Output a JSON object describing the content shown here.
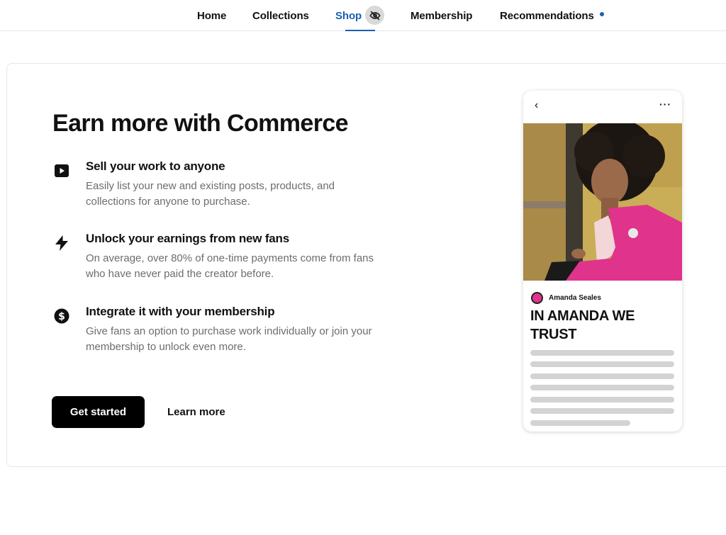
{
  "nav": {
    "items": [
      {
        "label": "Home"
      },
      {
        "label": "Collections"
      },
      {
        "label": "Shop"
      },
      {
        "label": "Membership"
      },
      {
        "label": "Recommendations"
      }
    ],
    "active": "Shop",
    "shop_icon": "eye-off-icon",
    "recommendations_badge": "unread-dot"
  },
  "promo": {
    "headline": "Earn more with Commerce",
    "features": [
      {
        "icon": "play-square-icon",
        "title": "Sell your work to anyone",
        "description": "Easily list your new and existing posts, products, and collections for anyone to purchase."
      },
      {
        "icon": "lightning-bolt-icon",
        "title": "Unlock your earnings from new fans",
        "description": "On average, over 80% of one-time payments come from fans who have never paid the creator before."
      },
      {
        "icon": "dollar-circle-icon",
        "title": "Integrate it with your membership",
        "description": "Give fans an option to purchase work individually or join your membership to unlock even more."
      }
    ],
    "primary_button": "Get started",
    "secondary_link": "Learn more"
  },
  "phone_preview": {
    "back_glyph": "‹",
    "more_glyph": "···",
    "author": "Amanda Seales",
    "post_title": "IN AMANDA WE TRUST"
  },
  "colors": {
    "accent": "#1b5fae",
    "button_bg": "#000000",
    "muted_text": "#6d6d6d",
    "skeleton": "#d3d3d3",
    "jacket_pink": "#e0338b"
  }
}
